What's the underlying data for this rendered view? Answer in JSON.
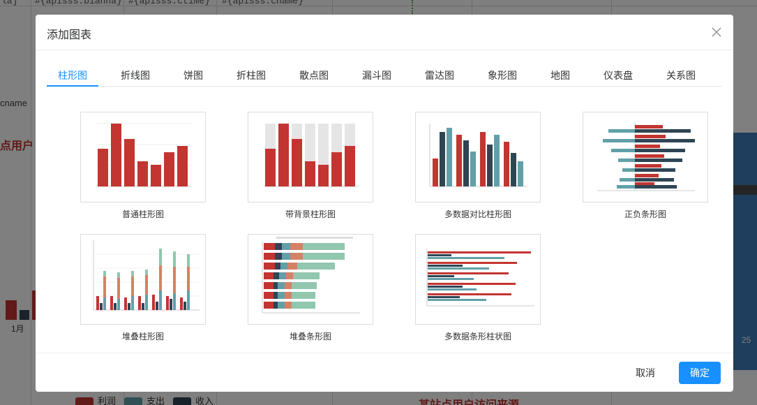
{
  "background": {
    "header_cells": [
      "la]",
      "#{apisss.bianha}",
      "#{apisss.ctime}",
      "#{apisss.chame}"
    ],
    "left_label": "cname",
    "left_title": "点用户",
    "bottom_title": "某站点用户访问来源",
    "month_label": "1月",
    "right_panel_number": "25",
    "legend": [
      {
        "label": "利润",
        "color": "#c23531"
      },
      {
        "label": "支出",
        "color": "#61a0a8"
      },
      {
        "label": "收入",
        "color": "#2f4554"
      }
    ]
  },
  "dialog": {
    "title": "添加图表",
    "close_icon": "close-icon",
    "tabs": [
      {
        "label": "柱形图",
        "active": true
      },
      {
        "label": "折线图"
      },
      {
        "label": "饼图"
      },
      {
        "label": "折柱图"
      },
      {
        "label": "散点图"
      },
      {
        "label": "漏斗图"
      },
      {
        "label": "雷达图"
      },
      {
        "label": "象形图"
      },
      {
        "label": "地图"
      },
      {
        "label": "仪表盘"
      },
      {
        "label": "关系图"
      }
    ],
    "charts": [
      {
        "label": "普通柱形图"
      },
      {
        "label": "带背景柱形图"
      },
      {
        "label": "多数据对比柱形图"
      },
      {
        "label": "正负条形图"
      },
      {
        "label": "堆叠柱形图"
      },
      {
        "label": "堆叠条形图"
      },
      {
        "label": "多数据条形柱状图"
      }
    ],
    "footer": {
      "cancel_label": "取消",
      "ok_label": "确定"
    }
  },
  "colors": {
    "accent": "#1890ff",
    "red": "#c23531",
    "dark": "#2f4554",
    "teal": "#61a0a8",
    "orange": "#d48265",
    "green": "#91c7ae"
  }
}
